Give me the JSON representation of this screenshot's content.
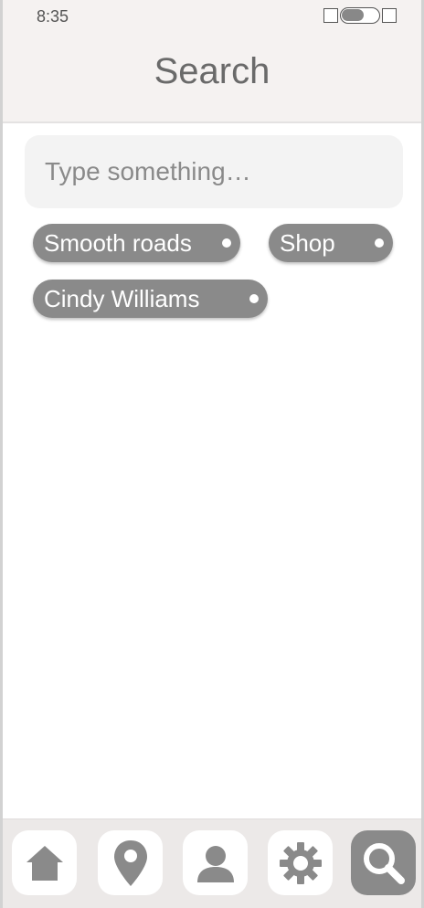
{
  "status_bar": {
    "time": "8:35"
  },
  "header": {
    "title": "Search"
  },
  "search": {
    "placeholder": "Type something…",
    "value": ""
  },
  "chips": [
    {
      "label": "Smooth roads"
    },
    {
      "label": "Shop"
    },
    {
      "label": "Cindy Williams"
    }
  ],
  "tab_bar": {
    "items": [
      {
        "icon": "home-icon",
        "active": false
      },
      {
        "icon": "map-pin-icon",
        "active": false
      },
      {
        "icon": "user-icon",
        "active": false
      },
      {
        "icon": "gear-icon",
        "active": false
      },
      {
        "icon": "search-icon",
        "active": true
      }
    ]
  },
  "colors": {
    "header_bg": "#f5f2f1",
    "chip_bg": "#8a8a8a",
    "icon": "#8a8a8a",
    "tabbar_bg": "#ece9e8"
  }
}
